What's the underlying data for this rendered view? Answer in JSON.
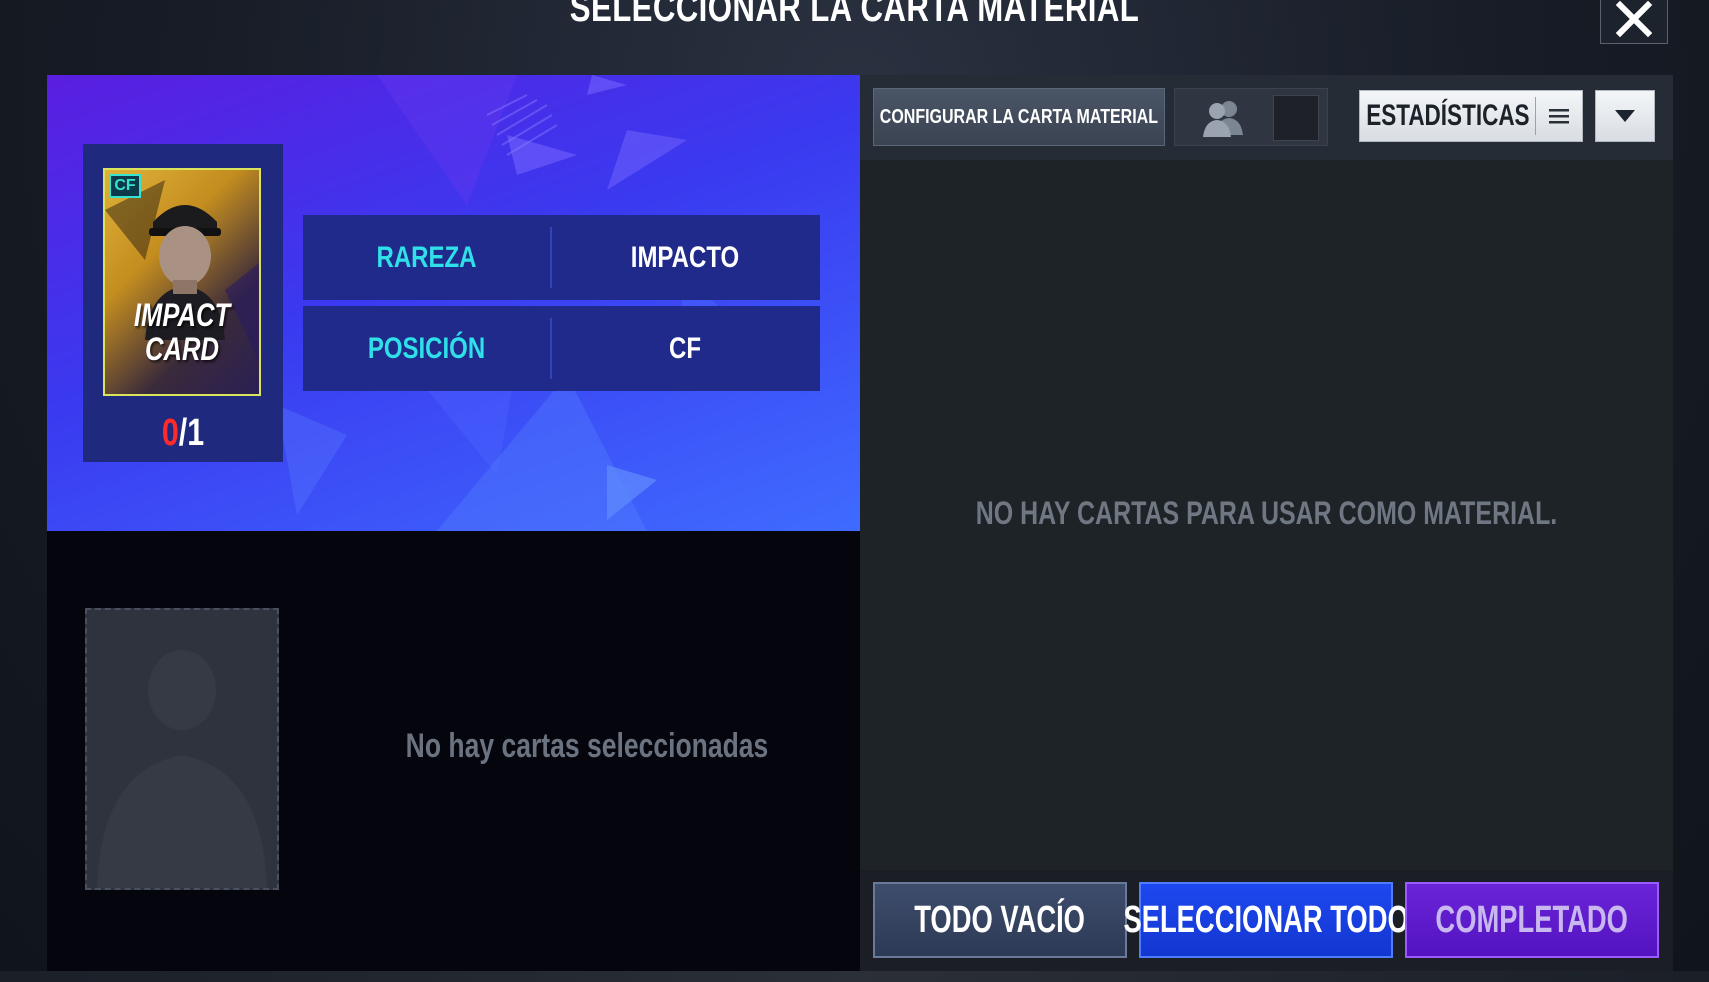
{
  "header": {
    "title": "SELECCIONAR LA CARTA MATERIAL",
    "close_icon": "close-icon"
  },
  "target_card": {
    "position_badge": "CF",
    "label_line1": "IMPACT",
    "label_line2": "CARD",
    "count_current": "0",
    "count_total": "/1",
    "info": [
      {
        "key": "RAREZA",
        "value": "IMPACTO"
      },
      {
        "key": "POSICIÓN",
        "value": "CF"
      }
    ]
  },
  "selected": {
    "empty_text": "No hay cartas seleccionadas"
  },
  "toolbar": {
    "configure_label": "CONFIGURAR LA CARTA MATERIAL",
    "stats_label": "ESTADÍSTICAS",
    "users_icon": "users-icon",
    "menu_icon": "menu-icon",
    "sort_icon": "triangle-down-icon"
  },
  "materials": {
    "empty_text": "NO HAY CARTAS PARA USAR COMO MATERIAL."
  },
  "footer": {
    "empty_all_label": "TODO VACÍO",
    "select_all_label": "SELECCIONAR TODO",
    "done_label": "COMPLETADO"
  },
  "colors": {
    "accent_blue": "#1236d0",
    "accent_purple": "#5313c0",
    "cyan_text": "#2fe0e8",
    "count_red": "#ff2a2a"
  }
}
